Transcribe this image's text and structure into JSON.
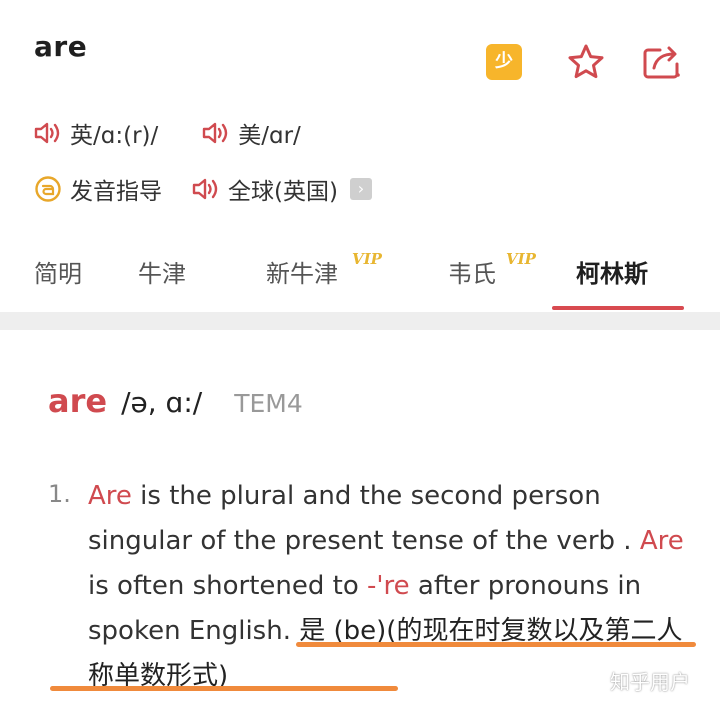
{
  "header": {
    "word": "are",
    "shao_badge": "少"
  },
  "pronunciation": {
    "uk_label": "英/ɑ:(r)/",
    "us_label": "美/ɑr/",
    "guide_label": "发音指导",
    "global_label": "全球(英国)",
    "arrow": "›"
  },
  "tabs": [
    {
      "label": "简明",
      "vip": ""
    },
    {
      "label": "牛津",
      "vip": ""
    },
    {
      "label": "新牛津",
      "vip": "VIP"
    },
    {
      "label": "韦氏",
      "vip": "VIP"
    },
    {
      "label": "柯林斯",
      "vip": "",
      "active": true
    }
  ],
  "entry": {
    "headword": "are",
    "ipa": "/ə, ɑ:/",
    "tag": "TEM4"
  },
  "definition": {
    "number": "1.",
    "seg1": "Are",
    "seg2": " is the plural and the second person singular of the present tense of the verb . ",
    "seg3": "Are",
    "seg4": " is often shortened to ",
    "seg5": "-'re",
    "seg6": " after pronouns in spoken English. ",
    "seg7": "是 (be)(的现在时复数以及第二人称单数形式)"
  },
  "watermark": "知乎用户",
  "colors": {
    "accent_red": "#d04a4f",
    "vip_gold": "#e8b631",
    "badge_orange": "#f7b52b",
    "underline_orange": "#f08a3c"
  }
}
